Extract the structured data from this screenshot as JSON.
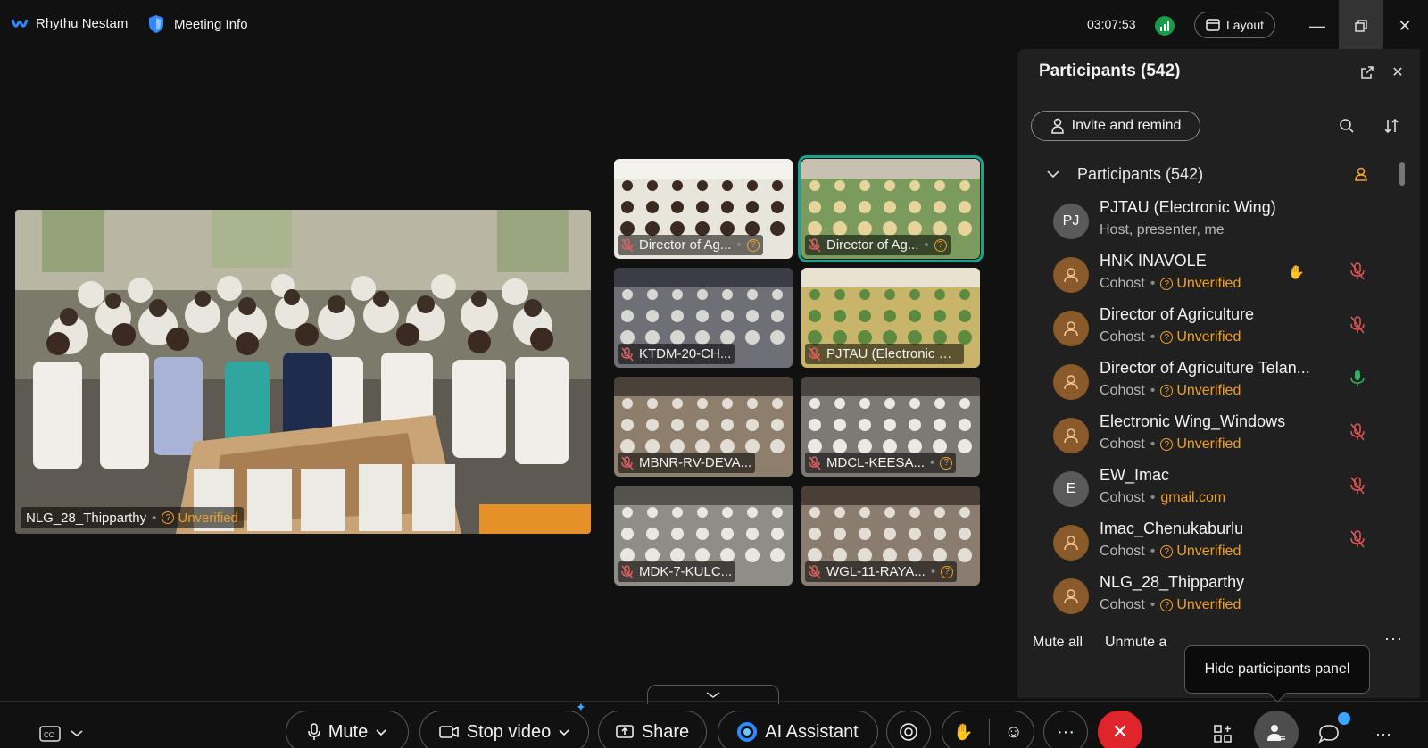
{
  "app": {
    "name": "Rhythu Nestam",
    "meeting_info": "Meeting Info"
  },
  "header": {
    "timer": "03:07:53",
    "layout_label": "Layout"
  },
  "main_video": {
    "name": "NLG_28_Thipparthy",
    "status": "Unverified"
  },
  "tiles": [
    {
      "name": "Director of Ag...",
      "unverified": true,
      "active": false
    },
    {
      "name": "Director of Ag...",
      "unverified": true,
      "active": true
    },
    {
      "name": "KTDM-20-CH...",
      "unverified": false,
      "active": false
    },
    {
      "name": "PJTAU (Electronic Win...",
      "unverified": false,
      "active": false
    },
    {
      "name": "MBNR-RV-DEVA...",
      "unverified": false,
      "active": false
    },
    {
      "name": "MDCL-KEESA...",
      "unverified": true,
      "active": false
    },
    {
      "name": "MDK-7-KULC...",
      "unverified": false,
      "active": false
    },
    {
      "name": "WGL-11-RAYA...",
      "unverified": true,
      "active": false
    }
  ],
  "panel": {
    "title": "Participants (542)",
    "invite_label": "Invite and remind",
    "section_label": "Participants (542)",
    "participants": [
      {
        "initials": "PJ",
        "name": "PJTAU (Electronic Wing)",
        "role": "Host, presenter, me",
        "status": "",
        "mic": "none",
        "avatar": "pj"
      },
      {
        "initials": "",
        "name": "HNK INAVOLE",
        "role": "Cohost",
        "status": "Unverified",
        "mic": "muted",
        "avatar": "orange",
        "hand": true
      },
      {
        "initials": "",
        "name": "Director of Agriculture",
        "role": "Cohost",
        "status": "Unverified",
        "mic": "muted",
        "avatar": "orange"
      },
      {
        "initials": "",
        "name": "Director of Agriculture Telan...",
        "role": "Cohost",
        "status": "Unverified",
        "mic": "on",
        "avatar": "orange"
      },
      {
        "initials": "",
        "name": "Electronic Wing_Windows",
        "role": "Cohost",
        "status": "Unverified",
        "mic": "muted",
        "avatar": "orange"
      },
      {
        "initials": "E",
        "name": "EW_Imac",
        "role": "Cohost",
        "status": "gmail.com",
        "mic": "muted",
        "avatar": "e"
      },
      {
        "initials": "",
        "name": "Imac_Chenukaburlu",
        "role": "Cohost",
        "status": "Unverified",
        "mic": "muted",
        "avatar": "orange"
      },
      {
        "initials": "",
        "name": "NLG_28_Thipparthy",
        "role": "Cohost",
        "status": "Unverified",
        "mic": "none",
        "avatar": "orange"
      }
    ],
    "mute_all": "Mute all",
    "unmute_all": "Unmute a",
    "tooltip": "Hide participants panel"
  },
  "toolbar": {
    "mute": "Mute",
    "stop_video": "Stop video",
    "share": "Share",
    "ai_assistant": "AI Assistant",
    "more": "···"
  },
  "colors": {
    "accent": "#18a58a",
    "warning": "#f0a028",
    "leave": "#e0242b",
    "bg": "#111111",
    "panel": "#202020"
  }
}
